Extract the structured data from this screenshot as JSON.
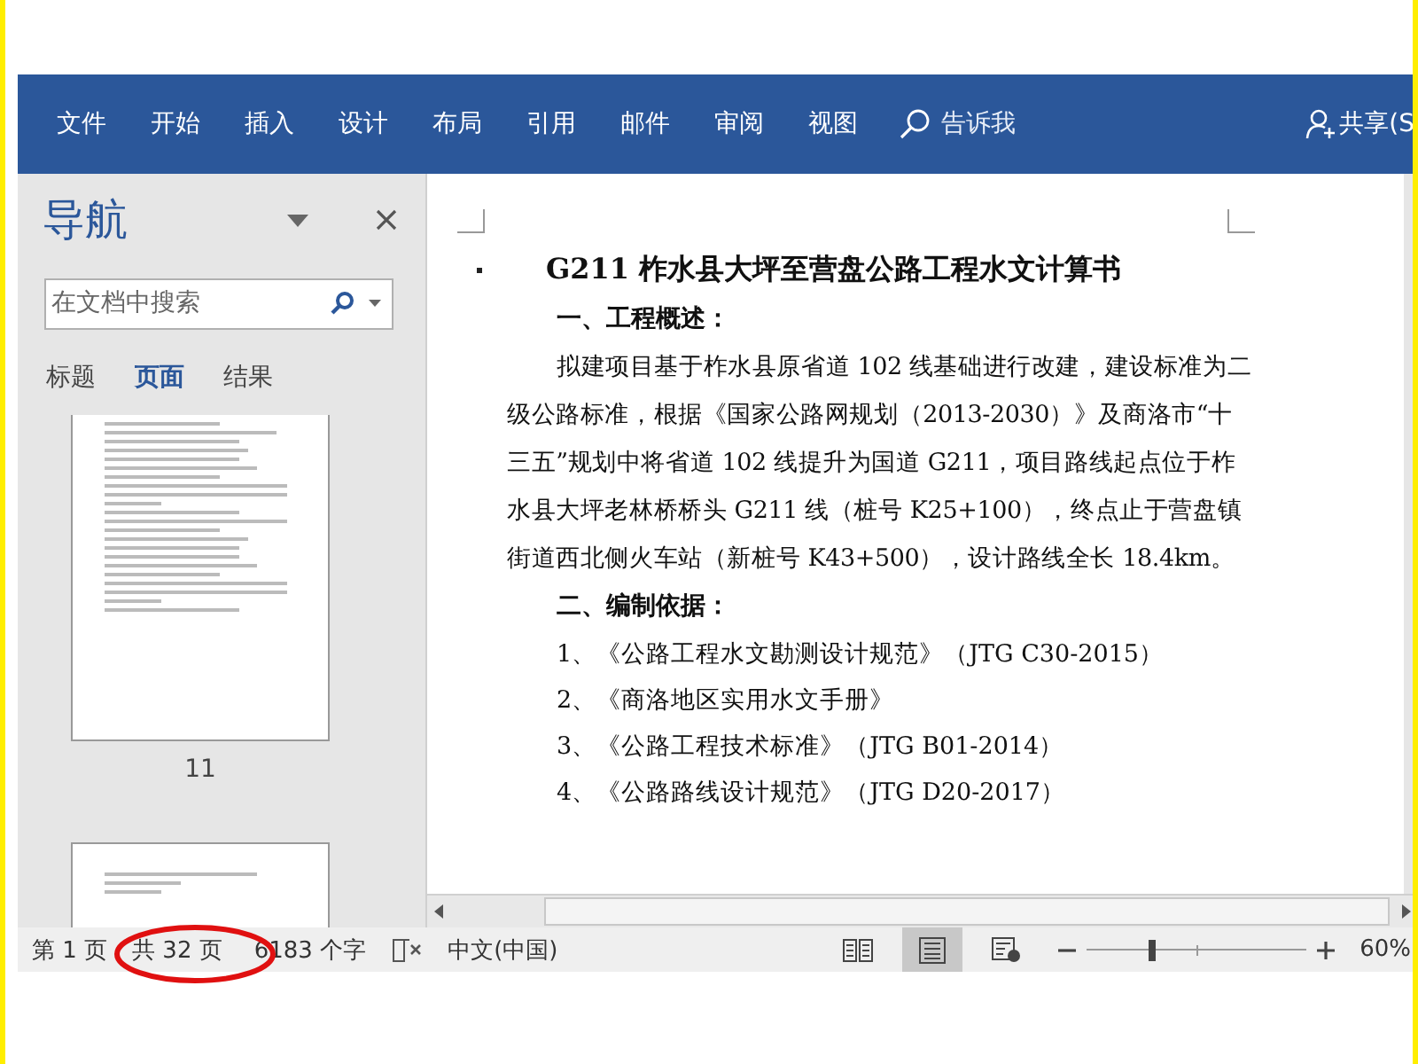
{
  "ribbon": {
    "tabs": [
      {
        "label": "文件"
      },
      {
        "label": "开始"
      },
      {
        "label": "插入"
      },
      {
        "label": "设计"
      },
      {
        "label": "布局"
      },
      {
        "label": "引用"
      },
      {
        "label": "邮件"
      },
      {
        "label": "审阅"
      },
      {
        "label": "视图"
      }
    ],
    "tell_me": "告诉我",
    "share": "共享(S"
  },
  "navigation": {
    "title": "导航",
    "search": {
      "placeholder": "在文档中搜索"
    },
    "tabs": [
      {
        "label": "标题",
        "selected": false
      },
      {
        "label": "页面",
        "selected": true
      },
      {
        "label": "结果",
        "selected": false
      }
    ],
    "page_label": "11"
  },
  "document": {
    "title": "G211 柞水县大坪至营盘公路工程水文计算书",
    "paragraphs": [
      {
        "kind": "heading",
        "text": "一、工程概述："
      },
      {
        "kind": "body",
        "text": "拟建项目基于柞水县原省道 102 线基础进行改建，建设标准为二级公路标准，根据《国家公路网规划（2013-2030）》及商洛市“十三五”规划中将省道 102 线提升为国道 G211，项目路线起点位于柞水县大坪老林桥桥头 G211 线（桩号 K25+100），终点止于营盘镇街道西北侧火车站（新桩号 K43+500），设计路线全长 18.4km。"
      },
      {
        "kind": "heading",
        "text": "二、编制依据："
      },
      {
        "kind": "item",
        "text": "1、《公路工程水文勘测设计规范》（JTG C30-2015）"
      },
      {
        "kind": "item",
        "text": "2、《商洛地区实用水文手册》"
      },
      {
        "kind": "item",
        "text": "3、《公路工程技术标准》（JTG B01-2014）"
      },
      {
        "kind": "item",
        "text": "4、《公路路线设计规范》（JTG D20-2017）"
      }
    ]
  },
  "status_bar": {
    "page": "第 1 页",
    "page_count": "共 32 页",
    "word_count": "6183 个字",
    "language": "中文(中国)",
    "views": [
      {
        "kind": "read",
        "selected": false
      },
      {
        "kind": "print",
        "selected": true
      },
      {
        "kind": "web",
        "selected": false
      }
    ],
    "zoom": {
      "level": 0.3,
      "reading": "60%"
    }
  }
}
